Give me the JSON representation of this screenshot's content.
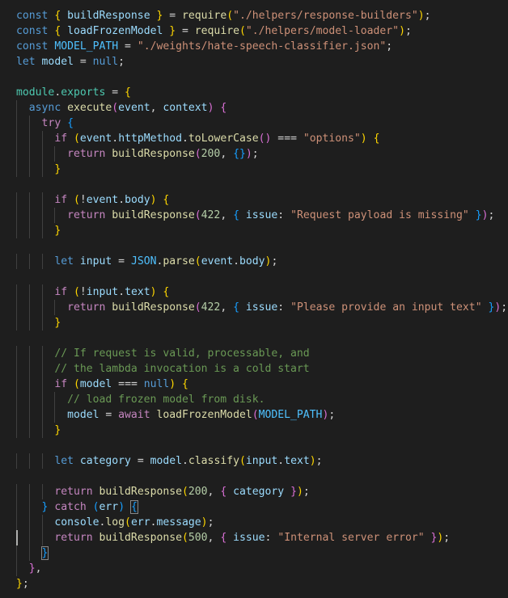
{
  "colors": {
    "background": "#1e1e1e",
    "keyword": "#569cd6",
    "control": "#c586c0",
    "variable": "#9cdcfe",
    "function": "#dcdcaa",
    "string": "#ce9178",
    "number": "#b5cea8",
    "comment": "#6a9955",
    "constant": "#4fc1ff",
    "bracket1": "#ffd700",
    "bracket2": "#da70d6",
    "bracket3": "#179fff"
  },
  "lines": [
    [
      [
        "k",
        "const"
      ],
      [
        "p",
        " "
      ],
      [
        "b1",
        "{"
      ],
      [
        "p",
        " "
      ],
      [
        "v",
        "buildResponse"
      ],
      [
        "p",
        " "
      ],
      [
        "b1",
        "}"
      ],
      [
        "p",
        " = "
      ],
      [
        "f",
        "require"
      ],
      [
        "b1",
        "("
      ],
      [
        "s",
        "\"./helpers/response-builders\""
      ],
      [
        "b1",
        ")"
      ],
      [
        "p",
        ";"
      ]
    ],
    [
      [
        "k",
        "const"
      ],
      [
        "p",
        " "
      ],
      [
        "b1",
        "{"
      ],
      [
        "p",
        " "
      ],
      [
        "v",
        "loadFrozenModel"
      ],
      [
        "p",
        " "
      ],
      [
        "b1",
        "}"
      ],
      [
        "p",
        " = "
      ],
      [
        "f",
        "require"
      ],
      [
        "b1",
        "("
      ],
      [
        "s",
        "\"./helpers/model-loader\""
      ],
      [
        "b1",
        ")"
      ],
      [
        "p",
        ";"
      ]
    ],
    [
      [
        "k",
        "const"
      ],
      [
        "p",
        " "
      ],
      [
        "cn",
        "MODEL_PATH"
      ],
      [
        "p",
        " = "
      ],
      [
        "s",
        "\"./weights/hate-speech-classifier.json\""
      ],
      [
        "p",
        ";"
      ]
    ],
    [
      [
        "k",
        "let"
      ],
      [
        "p",
        " "
      ],
      [
        "v",
        "model"
      ],
      [
        "p",
        " = "
      ],
      [
        "k",
        "null"
      ],
      [
        "p",
        ";"
      ]
    ],
    [],
    [
      [
        "t",
        "module"
      ],
      [
        "p",
        "."
      ],
      [
        "t",
        "exports"
      ],
      [
        "p",
        " = "
      ],
      [
        "b1",
        "{"
      ]
    ],
    [
      [
        "p",
        "  "
      ],
      [
        "k",
        "async"
      ],
      [
        "p",
        " "
      ],
      [
        "f",
        "execute"
      ],
      [
        "b2",
        "("
      ],
      [
        "v",
        "event"
      ],
      [
        "p",
        ", "
      ],
      [
        "v",
        "context"
      ],
      [
        "b2",
        ")"
      ],
      [
        "p",
        " "
      ],
      [
        "b2",
        "{"
      ]
    ],
    [
      [
        "p",
        "    "
      ],
      [
        "c",
        "try"
      ],
      [
        "p",
        " "
      ],
      [
        "b3",
        "{"
      ]
    ],
    [
      [
        "p",
        "      "
      ],
      [
        "c",
        "if"
      ],
      [
        "p",
        " "
      ],
      [
        "b1",
        "("
      ],
      [
        "v",
        "event"
      ],
      [
        "p",
        "."
      ],
      [
        "v",
        "httpMethod"
      ],
      [
        "p",
        "."
      ],
      [
        "f",
        "toLowerCase"
      ],
      [
        "b2",
        "()"
      ],
      [
        "p",
        " === "
      ],
      [
        "s",
        "\"options\""
      ],
      [
        "b1",
        ")"
      ],
      [
        "p",
        " "
      ],
      [
        "b1",
        "{"
      ]
    ],
    [
      [
        "p",
        "        "
      ],
      [
        "c",
        "return"
      ],
      [
        "p",
        " "
      ],
      [
        "f",
        "buildResponse"
      ],
      [
        "b2",
        "("
      ],
      [
        "n",
        "200"
      ],
      [
        "p",
        ", "
      ],
      [
        "b3",
        "{}"
      ],
      [
        "b2",
        ")"
      ],
      [
        "p",
        ";"
      ]
    ],
    [
      [
        "p",
        "      "
      ],
      [
        "b1",
        "}"
      ]
    ],
    [],
    [
      [
        "p",
        "      "
      ],
      [
        "c",
        "if"
      ],
      [
        "p",
        " "
      ],
      [
        "b1",
        "("
      ],
      [
        "p",
        "!"
      ],
      [
        "v",
        "event"
      ],
      [
        "p",
        "."
      ],
      [
        "v",
        "body"
      ],
      [
        "b1",
        ")"
      ],
      [
        "p",
        " "
      ],
      [
        "b1",
        "{"
      ]
    ],
    [
      [
        "p",
        "        "
      ],
      [
        "c",
        "return"
      ],
      [
        "p",
        " "
      ],
      [
        "f",
        "buildResponse"
      ],
      [
        "b2",
        "("
      ],
      [
        "n",
        "422"
      ],
      [
        "p",
        ", "
      ],
      [
        "b3",
        "{"
      ],
      [
        "p",
        " "
      ],
      [
        "v",
        "issue"
      ],
      [
        "p",
        ": "
      ],
      [
        "s",
        "\"Request payload is missing\""
      ],
      [
        "p",
        " "
      ],
      [
        "b3",
        "}"
      ],
      [
        "b2",
        ")"
      ],
      [
        "p",
        ";"
      ]
    ],
    [
      [
        "p",
        "      "
      ],
      [
        "b1",
        "}"
      ]
    ],
    [],
    [
      [
        "p",
        "      "
      ],
      [
        "k",
        "let"
      ],
      [
        "p",
        " "
      ],
      [
        "v",
        "input"
      ],
      [
        "p",
        " = "
      ],
      [
        "cn",
        "JSON"
      ],
      [
        "p",
        "."
      ],
      [
        "f",
        "parse"
      ],
      [
        "b1",
        "("
      ],
      [
        "v",
        "event"
      ],
      [
        "p",
        "."
      ],
      [
        "v",
        "body"
      ],
      [
        "b1",
        ")"
      ],
      [
        "p",
        ";"
      ]
    ],
    [],
    [
      [
        "p",
        "      "
      ],
      [
        "c",
        "if"
      ],
      [
        "p",
        " "
      ],
      [
        "b1",
        "("
      ],
      [
        "p",
        "!"
      ],
      [
        "v",
        "input"
      ],
      [
        "p",
        "."
      ],
      [
        "v",
        "text"
      ],
      [
        "b1",
        ")"
      ],
      [
        "p",
        " "
      ],
      [
        "b1",
        "{"
      ]
    ],
    [
      [
        "p",
        "        "
      ],
      [
        "c",
        "return"
      ],
      [
        "p",
        " "
      ],
      [
        "f",
        "buildResponse"
      ],
      [
        "b2",
        "("
      ],
      [
        "n",
        "422"
      ],
      [
        "p",
        ", "
      ],
      [
        "b3",
        "{"
      ],
      [
        "p",
        " "
      ],
      [
        "v",
        "issue"
      ],
      [
        "p",
        ": "
      ],
      [
        "s",
        "\"Please provide an input text\""
      ],
      [
        "p",
        " "
      ],
      [
        "b3",
        "}"
      ],
      [
        "b2",
        ")"
      ],
      [
        "p",
        ";"
      ]
    ],
    [
      [
        "p",
        "      "
      ],
      [
        "b1",
        "}"
      ]
    ],
    [],
    [
      [
        "p",
        "      "
      ],
      [
        "cm",
        "// If request is valid, processable, and"
      ]
    ],
    [
      [
        "p",
        "      "
      ],
      [
        "cm",
        "// the lambda invocation is a cold start"
      ]
    ],
    [
      [
        "p",
        "      "
      ],
      [
        "c",
        "if"
      ],
      [
        "p",
        " "
      ],
      [
        "b1",
        "("
      ],
      [
        "v",
        "model"
      ],
      [
        "p",
        " === "
      ],
      [
        "k",
        "null"
      ],
      [
        "b1",
        ")"
      ],
      [
        "p",
        " "
      ],
      [
        "b1",
        "{"
      ]
    ],
    [
      [
        "p",
        "        "
      ],
      [
        "cm",
        "// load frozen model from disk."
      ]
    ],
    [
      [
        "p",
        "        "
      ],
      [
        "v",
        "model"
      ],
      [
        "p",
        " = "
      ],
      [
        "c",
        "await"
      ],
      [
        "p",
        " "
      ],
      [
        "f",
        "loadFrozenModel"
      ],
      [
        "b2",
        "("
      ],
      [
        "cn",
        "MODEL_PATH"
      ],
      [
        "b2",
        ")"
      ],
      [
        "p",
        ";"
      ]
    ],
    [
      [
        "p",
        "      "
      ],
      [
        "b1",
        "}"
      ]
    ],
    [],
    [
      [
        "p",
        "      "
      ],
      [
        "k",
        "let"
      ],
      [
        "p",
        " "
      ],
      [
        "v",
        "category"
      ],
      [
        "p",
        " = "
      ],
      [
        "v",
        "model"
      ],
      [
        "p",
        "."
      ],
      [
        "f",
        "classify"
      ],
      [
        "b1",
        "("
      ],
      [
        "v",
        "input"
      ],
      [
        "p",
        "."
      ],
      [
        "v",
        "text"
      ],
      [
        "b1",
        ")"
      ],
      [
        "p",
        ";"
      ]
    ],
    [],
    [
      [
        "p",
        "      "
      ],
      [
        "c",
        "return"
      ],
      [
        "p",
        " "
      ],
      [
        "f",
        "buildResponse"
      ],
      [
        "b1",
        "("
      ],
      [
        "n",
        "200"
      ],
      [
        "p",
        ", "
      ],
      [
        "b2",
        "{"
      ],
      [
        "p",
        " "
      ],
      [
        "v",
        "category"
      ],
      [
        "p",
        " "
      ],
      [
        "b2",
        "}"
      ],
      [
        "b1",
        ")"
      ],
      [
        "p",
        ";"
      ]
    ],
    [
      [
        "p",
        "    "
      ],
      [
        "b3",
        "}"
      ],
      [
        "p",
        " "
      ],
      [
        "c",
        "catch"
      ],
      [
        "p",
        " "
      ],
      [
        "b3",
        "("
      ],
      [
        "v",
        "err"
      ],
      [
        "b3",
        ")"
      ],
      [
        "p",
        " "
      ],
      [
        "b3m",
        "{"
      ]
    ],
    [
      [
        "p",
        "      "
      ],
      [
        "v",
        "console"
      ],
      [
        "p",
        "."
      ],
      [
        "f",
        "log"
      ],
      [
        "b1",
        "("
      ],
      [
        "v",
        "err"
      ],
      [
        "p",
        "."
      ],
      [
        "v",
        "message"
      ],
      [
        "b1",
        ")"
      ],
      [
        "p",
        ";"
      ]
    ],
    [
      [
        "p",
        "      "
      ],
      [
        "c",
        "return"
      ],
      [
        "p",
        " "
      ],
      [
        "f",
        "buildResponse"
      ],
      [
        "b1",
        "("
      ],
      [
        "n",
        "500"
      ],
      [
        "p",
        ", "
      ],
      [
        "b2",
        "{"
      ],
      [
        "p",
        " "
      ],
      [
        "v",
        "issue"
      ],
      [
        "p",
        ": "
      ],
      [
        "s",
        "\"Internal server error\""
      ],
      [
        "p",
        " "
      ],
      [
        "b2",
        "}"
      ],
      [
        "b1",
        ")"
      ],
      [
        "p",
        ";"
      ]
    ],
    [
      [
        "p",
        "    "
      ],
      [
        "b3m",
        "}"
      ]
    ],
    [
      [
        "p",
        "  "
      ],
      [
        "b2",
        "}"
      ],
      [
        "p",
        ","
      ]
    ],
    [
      [
        "b1",
        "}"
      ],
      [
        "p",
        ";"
      ]
    ]
  ]
}
